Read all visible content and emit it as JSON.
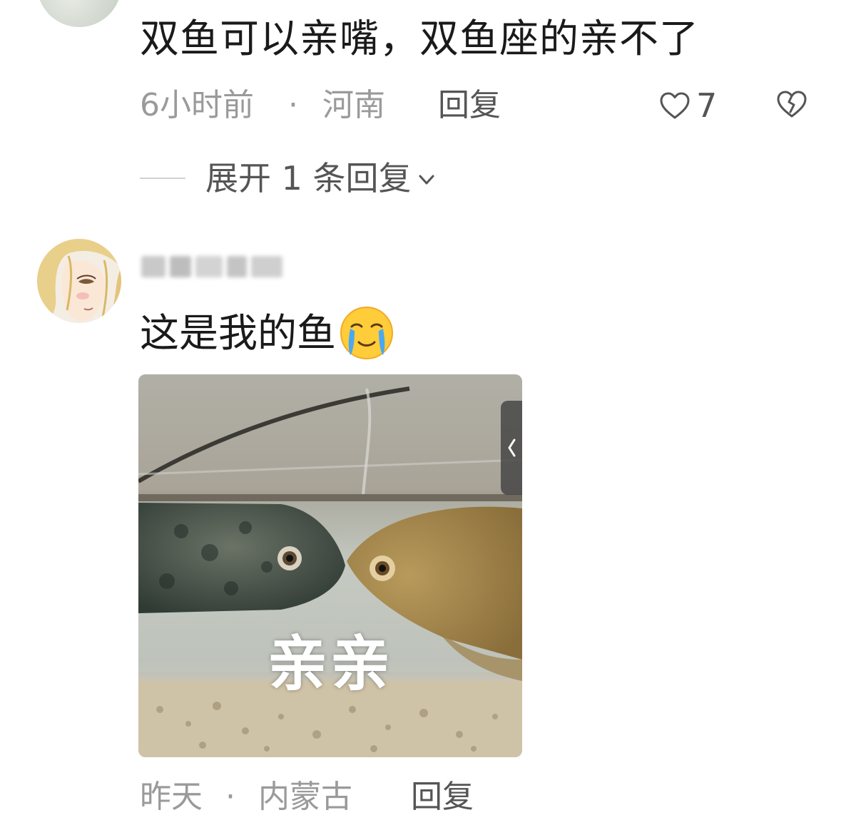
{
  "comment1": {
    "text": "双鱼可以亲嘴，双鱼座的亲不了",
    "time": "6小时前",
    "separator": "·",
    "location": "河南",
    "reply_label": "回复",
    "like_count": "7",
    "icons": {
      "like": "heart-outline-icon",
      "dislike": "broken-heart-icon"
    }
  },
  "expand": {
    "label": "展开 1 条回复",
    "icon": "chevron-down-icon"
  },
  "comment2": {
    "text": "这是我的鱼",
    "emoji": "crying-face-emoji",
    "image_caption": "亲亲",
    "time": "昨天",
    "separator": "·",
    "location": "内蒙古",
    "reply_label": "回复"
  },
  "colors": {
    "text": "#1a1a1a",
    "meta": "#9a9a9a",
    "action": "#555555",
    "background": "#ffffff"
  }
}
